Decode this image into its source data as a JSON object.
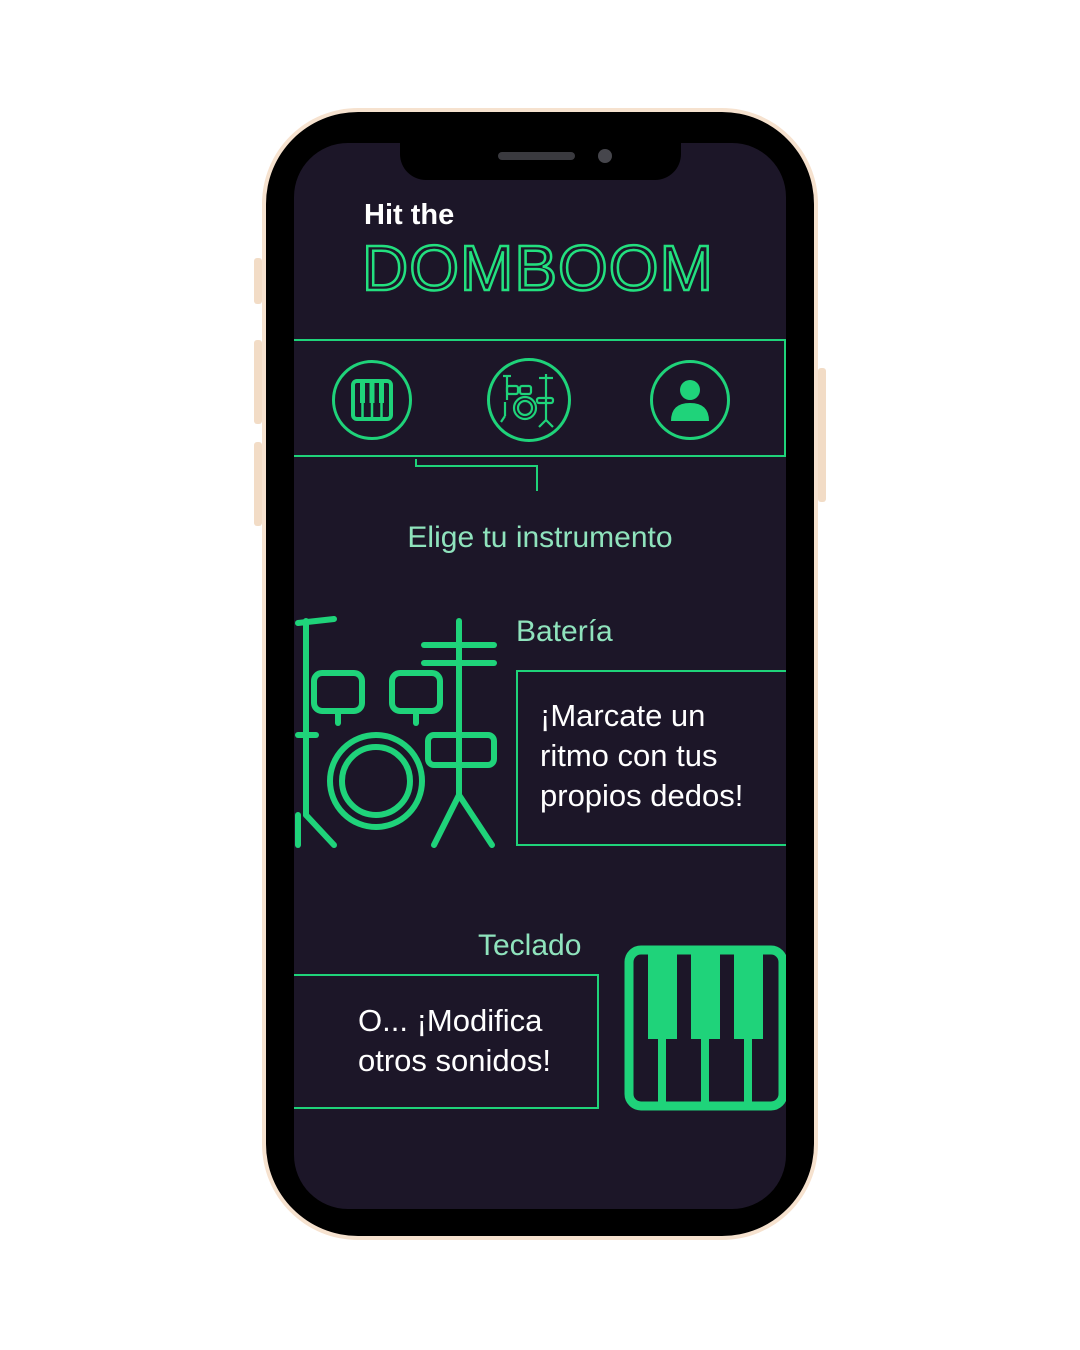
{
  "app": {
    "title_small": "Hit the",
    "title_big": "DOMBOOM"
  },
  "nav": {
    "items": [
      {
        "id": "piano",
        "icon": "piano-icon",
        "selected": false
      },
      {
        "id": "drums",
        "icon": "drum-kit-icon",
        "selected": true
      },
      {
        "id": "profile",
        "icon": "user-icon",
        "selected": false
      }
    ]
  },
  "main": {
    "heading": "Elige tu instrumento",
    "instruments": [
      {
        "label": "Batería",
        "description": "¡Marcate un ritmo con tus propios dedos!",
        "icon": "drum-kit-icon"
      },
      {
        "label": "Teclado",
        "description": "O... ¡Modifica otros sonidos!",
        "icon": "keyboard-icon"
      }
    ]
  },
  "colors": {
    "background": "#1c1628",
    "accent": "#1fd37a",
    "label": "#8fe3bd",
    "text": "#ffffff",
    "frame": "#f6e2cf"
  }
}
